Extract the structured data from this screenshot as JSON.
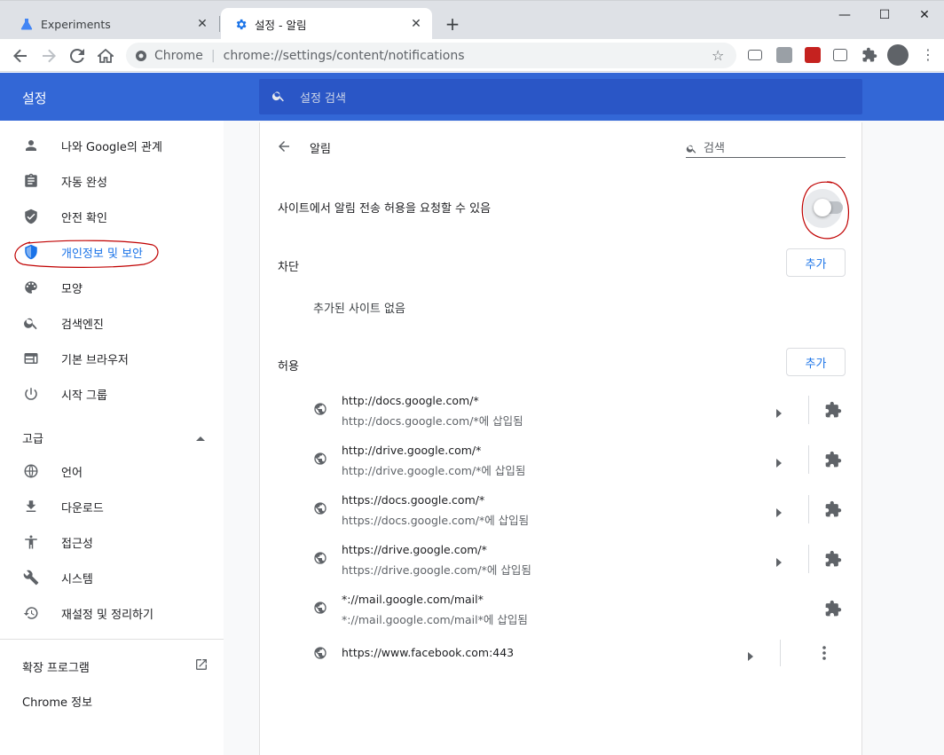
{
  "browser": {
    "tabs": [
      {
        "title": "Experiments",
        "active": false
      },
      {
        "title": "설정 - 알림",
        "active": true
      }
    ],
    "new_tab_symbol": "+",
    "window_controls": {
      "minimize": "—",
      "maximize": "☐",
      "close": "✕"
    },
    "omnibox": {
      "scheme_label": "Chrome",
      "separator": "|",
      "url": "chrome://settings/content/notifications"
    }
  },
  "settings": {
    "title": "설정",
    "search_placeholder": "설정 검색",
    "sidebar": {
      "items": [
        {
          "label": "나와 Google의 관계",
          "icon": "person-icon"
        },
        {
          "label": "자동 완성",
          "icon": "clipboard-icon"
        },
        {
          "label": "안전 확인",
          "icon": "shield-check-icon"
        },
        {
          "label": "개인정보 및 보안",
          "icon": "shield-icon",
          "selected": true
        },
        {
          "label": "모양",
          "icon": "palette-icon"
        },
        {
          "label": "검색엔진",
          "icon": "search-icon"
        },
        {
          "label": "기본 브라우저",
          "icon": "browser-icon"
        },
        {
          "label": "시작 그룹",
          "icon": "power-icon"
        }
      ],
      "advanced_label": "고급",
      "advanced_items": [
        {
          "label": "언어",
          "icon": "globe-icon"
        },
        {
          "label": "다운로드",
          "icon": "download-icon"
        },
        {
          "label": "접근성",
          "icon": "accessibility-icon"
        },
        {
          "label": "시스템",
          "icon": "wrench-icon"
        },
        {
          "label": "재설정 및 정리하기",
          "icon": "history-icon"
        }
      ],
      "extensions_label": "확장 프로그램",
      "about_label": "Chrome 정보"
    },
    "page": {
      "subtitle": "알림",
      "search_placeholder": "검색",
      "toggle_label": "사이트에서 알림 전송 허용을 요청할 수 있음",
      "toggle_on": false,
      "blocked": {
        "label": "차단",
        "add_label": "추가",
        "empty_text": "추가된 사이트 없음"
      },
      "allowed": {
        "label": "허용",
        "add_label": "추가",
        "sites": [
          {
            "url": "http://docs.google.com/*",
            "note": "http://docs.google.com/*에 삽입됨"
          },
          {
            "url": "http://drive.google.com/*",
            "note": "http://drive.google.com/*에 삽입됨"
          },
          {
            "url": "https://docs.google.com/*",
            "note": "https://docs.google.com/*에 삽입됨"
          },
          {
            "url": "https://drive.google.com/*",
            "note": "https://drive.google.com/*에 삽입됨"
          },
          {
            "url": "*://mail.google.com/mail*",
            "note": "*://mail.google.com/mail*에 삽입됨"
          },
          {
            "url": "https://www.facebook.com:443"
          }
        ]
      }
    }
  },
  "colors": {
    "header_blue": "#3367d6",
    "accent_blue": "#1a73e8",
    "annotation_red": "#c00000"
  }
}
